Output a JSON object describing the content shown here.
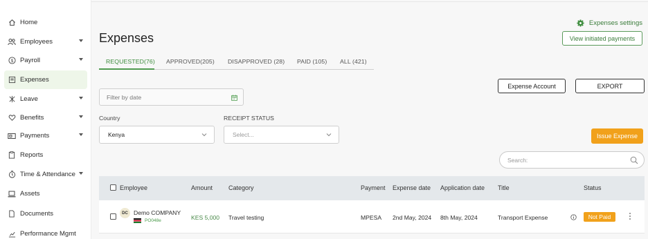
{
  "sidebar": {
    "items": [
      {
        "label": "Home",
        "icon": "home-icon",
        "caret": false,
        "active": false
      },
      {
        "label": "Employees",
        "icon": "users-icon",
        "caret": true,
        "active": false
      },
      {
        "label": "Payroll",
        "icon": "dollar-icon",
        "caret": true,
        "active": false
      },
      {
        "label": "Expenses",
        "icon": "receipt-icon",
        "caret": false,
        "active": true
      },
      {
        "label": "Leave",
        "icon": "leave-icon",
        "caret": true,
        "active": false
      },
      {
        "label": "Benefits",
        "icon": "heart-icon",
        "caret": true,
        "active": false
      },
      {
        "label": "Payments",
        "icon": "card-icon",
        "caret": true,
        "active": false
      },
      {
        "label": "Reports",
        "icon": "clipboard-icon",
        "caret": false,
        "active": false
      },
      {
        "label": "Time & Attendance",
        "icon": "clock-icon",
        "caret": true,
        "active": false
      },
      {
        "label": "Assets",
        "icon": "laptop-icon",
        "caret": false,
        "active": false
      },
      {
        "label": "Documents",
        "icon": "document-icon",
        "caret": false,
        "active": false
      },
      {
        "label": "Performance Mgmt",
        "icon": "chart-icon",
        "caret": false,
        "active": false
      }
    ]
  },
  "header": {
    "title": "Expenses",
    "settings_label": "Expenses settings",
    "view_initiated_label": "View initiated payments"
  },
  "tabs": [
    {
      "label": "REQUESTED(76)",
      "active": true
    },
    {
      "label": "APPROVED(205)",
      "active": false
    },
    {
      "label": "DISAPPROVED (28)",
      "active": false
    },
    {
      "label": "PAID (105)",
      "active": false
    },
    {
      "label": "ALL (421)",
      "active": false
    }
  ],
  "filters": {
    "date_placeholder": "Filter by date",
    "country_label": "Country",
    "country_value": "Kenya",
    "receipt_label": "RECEIPT STATUS",
    "receipt_placeholder": "Select..."
  },
  "actions": {
    "expense_account_label": "Expense Account",
    "export_label": "EXPORT",
    "issue_expense_label": "Issue Expense",
    "search_placeholder": "Search:"
  },
  "table": {
    "columns": [
      "Employee",
      "Amount",
      "Category",
      "Payment",
      "Expense date",
      "Application date",
      "Title",
      "Status"
    ],
    "rows": [
      {
        "initials": "DC",
        "name": "Demo COMPANY",
        "code": "PO048e",
        "amount": "KES 5,000",
        "category": "Travel testing",
        "payment": "MPESA",
        "expense_date": "2nd May, 2024",
        "application_date": "8th May, 2024",
        "title": "Transport Expense",
        "status": "Not Paid"
      }
    ]
  },
  "colors": {
    "accent_green": "#3d8c3d",
    "orange": "#f1a11b",
    "active_bg": "#eef6e9"
  }
}
